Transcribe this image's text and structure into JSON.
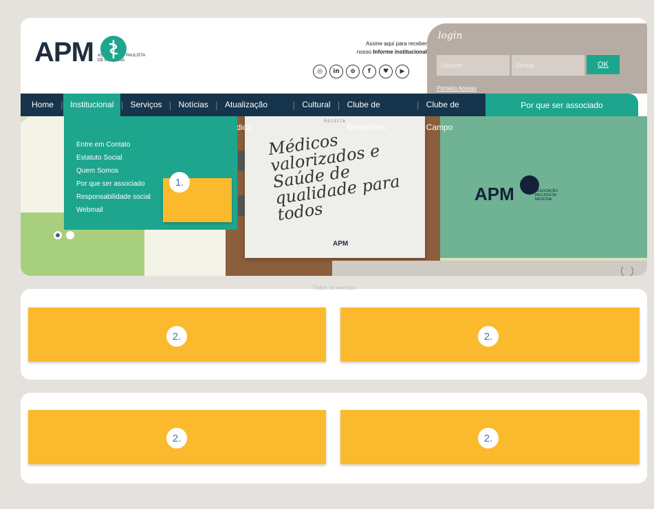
{
  "brand": {
    "logo_text": "APM",
    "logo_subtitle": "ASSOCIAÇÃO PAULISTA DE MEDICINA",
    "accent": "#1ea58d",
    "navy": "#16344b",
    "highlight": "#fbba2e"
  },
  "newsletter": {
    "line1": "Assine aqui para receber",
    "line2_prefix": "nosso ",
    "line2_bold": "Informe institucional"
  },
  "social_icons": [
    "instagram-icon",
    "linkedin-icon",
    "flickr-icon",
    "facebook-icon",
    "twitter-icon",
    "youtube-icon"
  ],
  "social_glyphs": [
    "◎",
    "in",
    "⊚",
    "f",
    "♥",
    "▶"
  ],
  "login": {
    "title": "login",
    "user_placeholder": "Usuário",
    "pass_placeholder": "Senha",
    "ok_label": "OK",
    "first_access": "Primeiro Acesso"
  },
  "nav": {
    "items": [
      "Home",
      "Institucional",
      "Serviços",
      "Notícias",
      "Atualização Médica",
      "Cultural",
      "Clube de Benefícios",
      "Clube de Campo"
    ],
    "cta": "Por que ser associado"
  },
  "dropdown": {
    "items": [
      "Entre em Contato",
      "Estatuto Social",
      "Quem Somos",
      "Por que ser associado",
      "Responsabilidade social",
      "Webmail"
    ]
  },
  "hero": {
    "paper_header": "RECEITA",
    "paper_text": "Médicos valorizados e Saúde de qualidade para todos",
    "paper_logo": "APM",
    "right_logo": "APM",
    "right_logo_sub": "ASSOCIAÇÃO PAULISTA DE MEDICINA"
  },
  "events_title": "Todos os eventos",
  "badges": {
    "one": "1.",
    "two": "2."
  }
}
